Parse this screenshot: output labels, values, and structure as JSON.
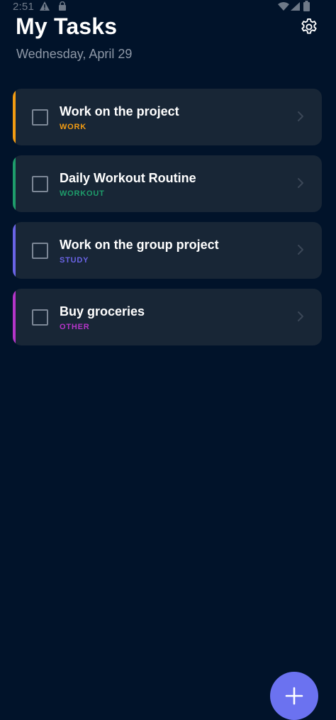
{
  "status_bar": {
    "time": "2:51",
    "icons": [
      "alert-icon",
      "lock-icon",
      "wifi-icon",
      "signal-icon",
      "battery-icon"
    ]
  },
  "header": {
    "title": "My Tasks",
    "date": "Wednesday, April 29",
    "settings_icon": "gear-icon"
  },
  "tasks": [
    {
      "title": "Work on the project",
      "category": "WORK",
      "color": "#f39c12"
    },
    {
      "title": "Daily Workout Routine",
      "category": "WORKOUT",
      "color": "#1e9d6b"
    },
    {
      "title": "Work on the group project",
      "category": "STUDY",
      "color": "#6a64e6"
    },
    {
      "title": "Buy groceries",
      "category": "OTHER",
      "color": "#b535c9"
    }
  ],
  "fab": {
    "icon": "plus-icon",
    "color": "#6b72f0"
  },
  "colors": {
    "background": "#01132a",
    "card": "#182636",
    "subtitle": "#8e98a7"
  }
}
